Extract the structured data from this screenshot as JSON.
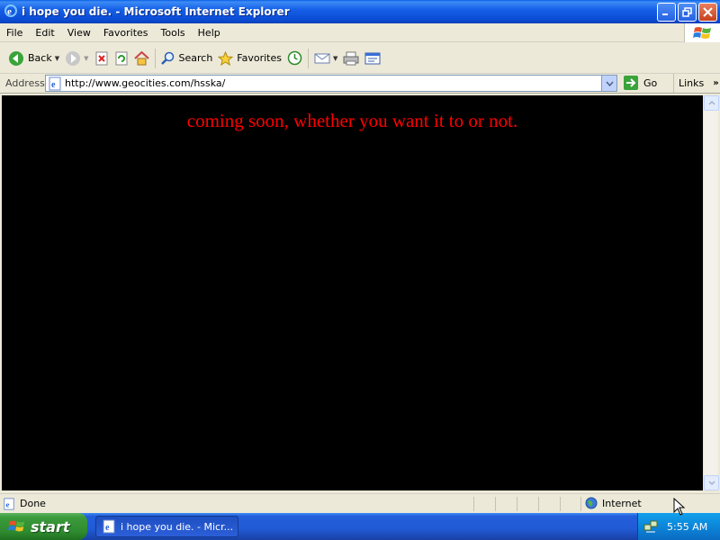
{
  "window": {
    "title": "i hope you die. - Microsoft Internet Explorer"
  },
  "menu": {
    "items": [
      "File",
      "Edit",
      "View",
      "Favorites",
      "Tools",
      "Help"
    ]
  },
  "toolbar": {
    "back": "Back",
    "search": "Search",
    "favorites": "Favorites"
  },
  "address": {
    "label": "Address",
    "url": "http://www.geocities.com/hsska/",
    "go": "Go",
    "links": "Links"
  },
  "page": {
    "text": "coming soon, whether you want it to or not."
  },
  "status": {
    "text": "Done",
    "zone": "Internet"
  },
  "taskbar": {
    "start": "start",
    "task": "i hope you die. - Micr...",
    "clock": "5:55 AM"
  },
  "colors": {
    "page_bg": "#000000",
    "page_text": "#ff0000",
    "titlebar": "#0b4bd4"
  }
}
